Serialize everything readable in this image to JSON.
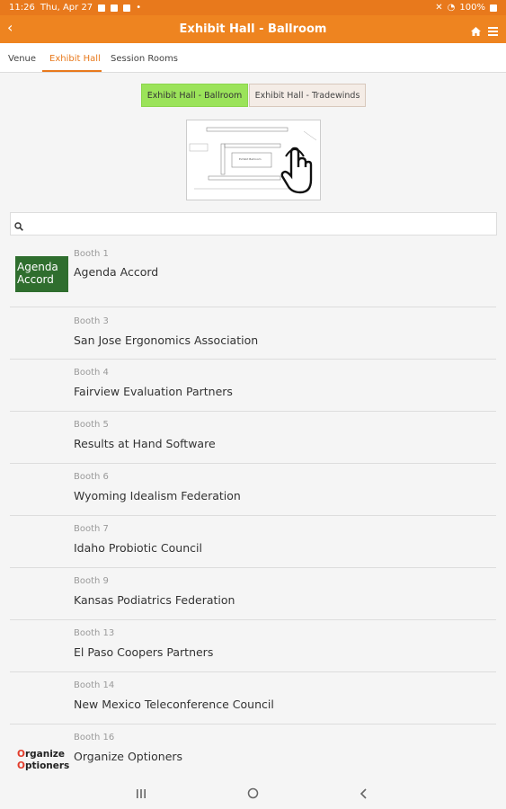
{
  "status": {
    "time": "11:26",
    "date": "Thu, Apr 27",
    "battery": "100%"
  },
  "appbar": {
    "title": "Exhibit Hall - Ballroom"
  },
  "tabs": [
    {
      "label": "Venue"
    },
    {
      "label": "Exhibit Hall"
    },
    {
      "label": "Session Rooms"
    }
  ],
  "segments": {
    "selected": "Exhibit Hall - Ballroom",
    "other": "Exhibit Hall - Tradewinds"
  },
  "map": {
    "label": "Exhibit Ballroom"
  },
  "search": {
    "placeholder": "",
    "value": ""
  },
  "booths": [
    {
      "booth": "Booth 1",
      "name": "Agenda Accord",
      "logo": "Agenda Accord"
    },
    {
      "booth": "Booth 3",
      "name": "San Jose Ergonomics Association"
    },
    {
      "booth": "Booth 4",
      "name": "Fairview Evaluation Partners"
    },
    {
      "booth": "Booth 5",
      "name": "Results at Hand Software"
    },
    {
      "booth": "Booth 6",
      "name": "Wyoming Idealism Federation"
    },
    {
      "booth": "Booth 7",
      "name": "Idaho Probiotic Council"
    },
    {
      "booth": "Booth 9",
      "name": "Kansas Podiatrics Federation"
    },
    {
      "booth": "Booth 13",
      "name": "El Paso Coopers Partners"
    },
    {
      "booth": "Booth 14",
      "name": "New Mexico Teleconference Council"
    },
    {
      "booth": "Booth 16",
      "name": "Organize Optioners",
      "logo_line1": "rganize",
      "logo_line2": "ptioners",
      "logo_letter": "O"
    }
  ],
  "colors": {
    "brand": "#ee8420",
    "selected_segment": "#9be35a",
    "logo_green": "#2f6e2e"
  },
  "icons": [
    "back-arrow-icon",
    "home-icon",
    "menu-icon",
    "search-icon",
    "hand-pointer-icon"
  ]
}
